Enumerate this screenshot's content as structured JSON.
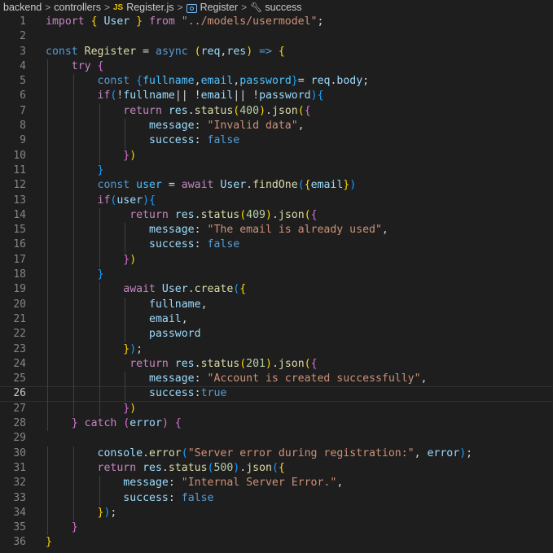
{
  "breadcrumb": {
    "items": [
      "backend",
      "controllers",
      "Register.js",
      "Register",
      "success"
    ],
    "separator": ">",
    "file_icon_label": "JS"
  },
  "editor": {
    "current_line": 26,
    "lines": [
      {
        "n": 1,
        "t": [
          [
            "import ",
            "ctl"
          ],
          [
            "{ ",
            "b1"
          ],
          [
            "User ",
            "var"
          ],
          [
            "} ",
            "b1"
          ],
          [
            "from ",
            "ctl"
          ],
          [
            "\"../models/usermodel\"",
            "str"
          ],
          [
            ";",
            "txt"
          ]
        ]
      },
      {
        "n": 2,
        "t": []
      },
      {
        "n": 3,
        "t": [
          [
            "const ",
            "kw"
          ],
          [
            "Register ",
            "fn"
          ],
          [
            "= ",
            "txt"
          ],
          [
            "async ",
            "kw"
          ],
          [
            "(",
            "b1"
          ],
          [
            "req",
            "var"
          ],
          [
            ",",
            "txt"
          ],
          [
            "res",
            "var"
          ],
          [
            ") ",
            "b1"
          ],
          [
            "=> ",
            "kw"
          ],
          [
            "{",
            "b1"
          ]
        ]
      },
      {
        "n": 4,
        "t": [
          [
            "    try ",
            "ctl"
          ],
          [
            "{",
            "b2"
          ]
        ]
      },
      {
        "n": 5,
        "t": [
          [
            "        const ",
            "kw"
          ],
          [
            "{",
            "b3"
          ],
          [
            "fullname",
            "const"
          ],
          [
            ",",
            "txt"
          ],
          [
            "email",
            "const"
          ],
          [
            ",",
            "txt"
          ],
          [
            "password",
            "const"
          ],
          [
            "}",
            "b3"
          ],
          [
            "= ",
            "txt"
          ],
          [
            "req",
            "var"
          ],
          [
            ".",
            "txt"
          ],
          [
            "body",
            "var"
          ],
          [
            ";",
            "txt"
          ]
        ]
      },
      {
        "n": 6,
        "t": [
          [
            "        if",
            "ctl"
          ],
          [
            "(",
            "b3"
          ],
          [
            "!",
            "txt"
          ],
          [
            "fullname",
            "var"
          ],
          [
            "|| ",
            "txt"
          ],
          [
            "!",
            "txt"
          ],
          [
            "email",
            "var"
          ],
          [
            "|| ",
            "txt"
          ],
          [
            "!",
            "txt"
          ],
          [
            "password",
            "var"
          ],
          [
            ")",
            "b3"
          ],
          [
            "{",
            "b3"
          ]
        ]
      },
      {
        "n": 7,
        "t": [
          [
            "            return ",
            "ctl"
          ],
          [
            "res",
            "var"
          ],
          [
            ".",
            "txt"
          ],
          [
            "status",
            "fn"
          ],
          [
            "(",
            "b1"
          ],
          [
            "400",
            "num"
          ],
          [
            ")",
            "b1"
          ],
          [
            ".",
            "txt"
          ],
          [
            "json",
            "fn"
          ],
          [
            "(",
            "b1"
          ],
          [
            "{",
            "b2"
          ]
        ]
      },
      {
        "n": 8,
        "t": [
          [
            "                message",
            "var"
          ],
          [
            ": ",
            "txt"
          ],
          [
            "\"Invalid data\"",
            "str"
          ],
          [
            ",",
            "txt"
          ]
        ]
      },
      {
        "n": 9,
        "t": [
          [
            "                success",
            "var"
          ],
          [
            ": ",
            "txt"
          ],
          [
            "false",
            "kw"
          ]
        ]
      },
      {
        "n": 10,
        "t": [
          [
            "            }",
            "b2"
          ],
          [
            ")",
            "b1"
          ]
        ]
      },
      {
        "n": 11,
        "t": [
          [
            "        }",
            "b3"
          ]
        ]
      },
      {
        "n": 12,
        "t": [
          [
            "        const ",
            "kw"
          ],
          [
            "user ",
            "const"
          ],
          [
            "= ",
            "txt"
          ],
          [
            "await ",
            "ctl"
          ],
          [
            "User",
            "var"
          ],
          [
            ".",
            "txt"
          ],
          [
            "findOne",
            "fn"
          ],
          [
            "(",
            "b3"
          ],
          [
            "{",
            "b1"
          ],
          [
            "email",
            "var"
          ],
          [
            "}",
            "b1"
          ],
          [
            ")",
            "b3"
          ]
        ]
      },
      {
        "n": 13,
        "t": [
          [
            "        if",
            "ctl"
          ],
          [
            "(",
            "b3"
          ],
          [
            "user",
            "var"
          ],
          [
            ")",
            "b3"
          ],
          [
            "{",
            "b3"
          ]
        ]
      },
      {
        "n": 14,
        "t": [
          [
            "             return ",
            "ctl"
          ],
          [
            "res",
            "var"
          ],
          [
            ".",
            "txt"
          ],
          [
            "status",
            "fn"
          ],
          [
            "(",
            "b1"
          ],
          [
            "409",
            "num"
          ],
          [
            ")",
            "b1"
          ],
          [
            ".",
            "txt"
          ],
          [
            "json",
            "fn"
          ],
          [
            "(",
            "b1"
          ],
          [
            "{",
            "b2"
          ]
        ]
      },
      {
        "n": 15,
        "t": [
          [
            "                message",
            "var"
          ],
          [
            ": ",
            "txt"
          ],
          [
            "\"The email is already used\"",
            "str"
          ],
          [
            ",",
            "txt"
          ]
        ]
      },
      {
        "n": 16,
        "t": [
          [
            "                success",
            "var"
          ],
          [
            ": ",
            "txt"
          ],
          [
            "false",
            "kw"
          ]
        ]
      },
      {
        "n": 17,
        "t": [
          [
            "            }",
            "b2"
          ],
          [
            ")",
            "b1"
          ]
        ]
      },
      {
        "n": 18,
        "t": [
          [
            "        }",
            "b3"
          ]
        ]
      },
      {
        "n": 19,
        "t": [
          [
            "            await ",
            "ctl"
          ],
          [
            "User",
            "var"
          ],
          [
            ".",
            "txt"
          ],
          [
            "create",
            "fn"
          ],
          [
            "(",
            "b3"
          ],
          [
            "{",
            "b1"
          ]
        ]
      },
      {
        "n": 20,
        "t": [
          [
            "                fullname",
            "var"
          ],
          [
            ",",
            "txt"
          ]
        ]
      },
      {
        "n": 21,
        "t": [
          [
            "                email",
            "var"
          ],
          [
            ",",
            "txt"
          ]
        ]
      },
      {
        "n": 22,
        "t": [
          [
            "                password",
            "var"
          ]
        ]
      },
      {
        "n": 23,
        "t": [
          [
            "            }",
            "b1"
          ],
          [
            ")",
            "b3"
          ],
          [
            ";",
            "txt"
          ]
        ]
      },
      {
        "n": 24,
        "t": [
          [
            "             return ",
            "ctl"
          ],
          [
            "res",
            "var"
          ],
          [
            ".",
            "txt"
          ],
          [
            "status",
            "fn"
          ],
          [
            "(",
            "b1"
          ],
          [
            "201",
            "num"
          ],
          [
            ")",
            "b1"
          ],
          [
            ".",
            "txt"
          ],
          [
            "json",
            "fn"
          ],
          [
            "(",
            "b1"
          ],
          [
            "{",
            "b2"
          ]
        ]
      },
      {
        "n": 25,
        "t": [
          [
            "                message",
            "var"
          ],
          [
            ": ",
            "txt"
          ],
          [
            "\"Account is created successfully\"",
            "str"
          ],
          [
            ",",
            "txt"
          ]
        ]
      },
      {
        "n": 26,
        "t": [
          [
            "                success",
            "var"
          ],
          [
            ":",
            "txt"
          ],
          [
            "true",
            "kw"
          ]
        ]
      },
      {
        "n": 27,
        "t": [
          [
            "            }",
            "b2"
          ],
          [
            ")",
            "b1"
          ]
        ]
      },
      {
        "n": 28,
        "t": [
          [
            "    }",
            "b2"
          ],
          [
            " catch ",
            "ctl"
          ],
          [
            "(",
            "b2"
          ],
          [
            "error",
            "var"
          ],
          [
            ") ",
            "b2"
          ],
          [
            "{",
            "b2"
          ]
        ]
      },
      {
        "n": 29,
        "t": []
      },
      {
        "n": 30,
        "t": [
          [
            "        console",
            "var"
          ],
          [
            ".",
            "txt"
          ],
          [
            "error",
            "fn"
          ],
          [
            "(",
            "b3"
          ],
          [
            "\"Server error during registration:\"",
            "str"
          ],
          [
            ", ",
            "txt"
          ],
          [
            "error",
            "var"
          ],
          [
            ")",
            "b3"
          ],
          [
            ";",
            "txt"
          ]
        ]
      },
      {
        "n": 31,
        "t": [
          [
            "        return ",
            "ctl"
          ],
          [
            "res",
            "var"
          ],
          [
            ".",
            "txt"
          ],
          [
            "status",
            "fn"
          ],
          [
            "(",
            "b3"
          ],
          [
            "500",
            "num"
          ],
          [
            ")",
            "b3"
          ],
          [
            ".",
            "txt"
          ],
          [
            "json",
            "fn"
          ],
          [
            "(",
            "b3"
          ],
          [
            "{",
            "b1"
          ]
        ]
      },
      {
        "n": 32,
        "t": [
          [
            "            message",
            "var"
          ],
          [
            ": ",
            "txt"
          ],
          [
            "\"Internal Server Error.\"",
            "str"
          ],
          [
            ",",
            "txt"
          ]
        ]
      },
      {
        "n": 33,
        "t": [
          [
            "            success",
            "var"
          ],
          [
            ": ",
            "txt"
          ],
          [
            "false",
            "kw"
          ]
        ]
      },
      {
        "n": 34,
        "t": [
          [
            "        }",
            "b1"
          ],
          [
            ")",
            "b3"
          ],
          [
            ";",
            "txt"
          ]
        ]
      },
      {
        "n": 35,
        "t": [
          [
            "    }",
            "b2"
          ]
        ]
      },
      {
        "n": 36,
        "t": [
          [
            "}",
            "b1"
          ]
        ]
      }
    ]
  }
}
